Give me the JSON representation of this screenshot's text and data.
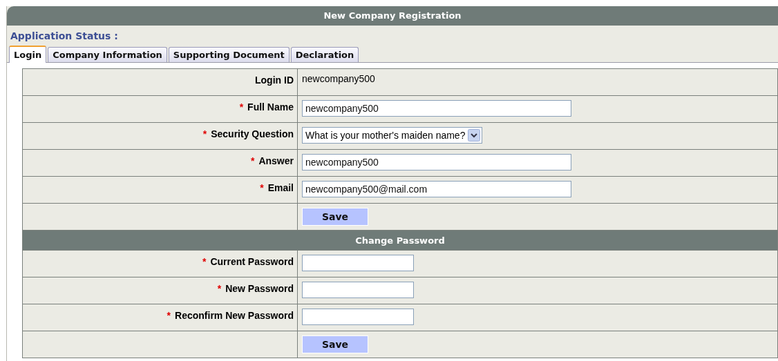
{
  "window": {
    "title": "New Company Registration"
  },
  "status_label": "Application Status :",
  "tabs": [
    {
      "label": "Login",
      "selected": true
    },
    {
      "label": "Company Information",
      "selected": false
    },
    {
      "label": "Supporting Document",
      "selected": false
    },
    {
      "label": "Declaration",
      "selected": false
    }
  ],
  "sections": [
    {
      "rows": [
        {
          "kind": "text",
          "label": "Login ID",
          "required": false,
          "value": "newcompany500"
        },
        {
          "kind": "input",
          "label": "Full Name",
          "required": true,
          "value": "newcompany500"
        },
        {
          "kind": "select",
          "label": "Security Question",
          "required": true,
          "value": "What is your mother's maiden name?"
        },
        {
          "kind": "input",
          "label": "Answer",
          "required": true,
          "value": "newcompany500"
        },
        {
          "kind": "input",
          "label": "Email",
          "required": true,
          "value": "newcompany500@mail.com"
        }
      ],
      "button": "Save"
    },
    {
      "title": "Change Password",
      "rows": [
        {
          "kind": "password",
          "label": "Current Password",
          "required": true
        },
        {
          "kind": "password",
          "label": "New Password",
          "required": true
        },
        {
          "kind": "password",
          "label": "Reconfirm New Password",
          "required": true
        }
      ],
      "button": "Save"
    }
  ],
  "required_mark": "*"
}
